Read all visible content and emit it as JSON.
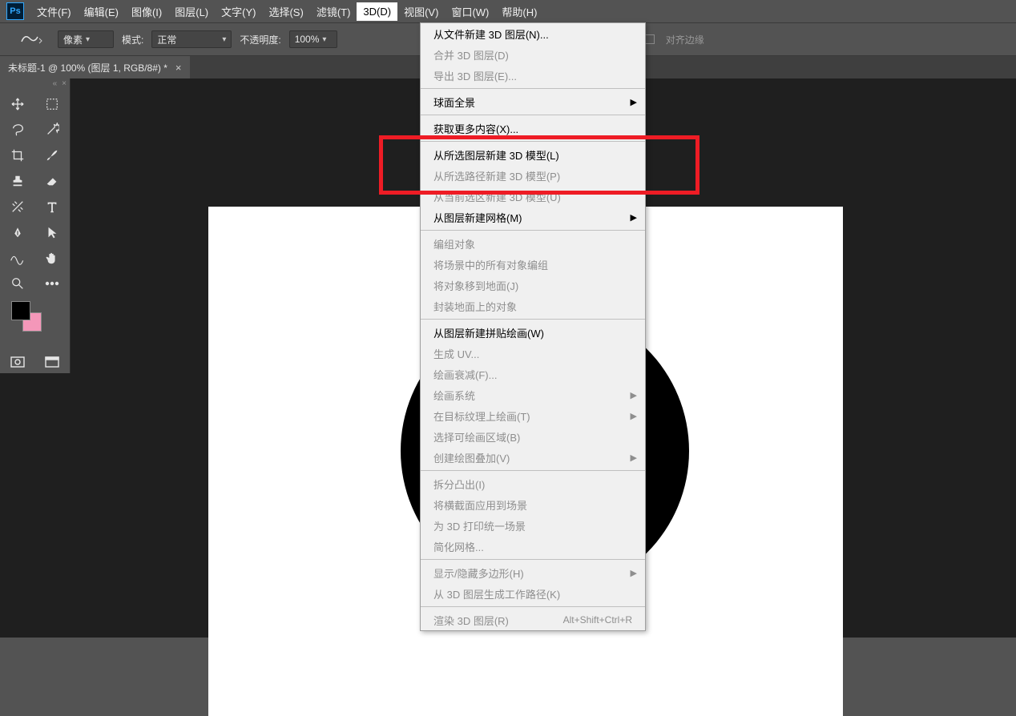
{
  "menubar": {
    "items": [
      {
        "label": "文件(F)"
      },
      {
        "label": "编辑(E)"
      },
      {
        "label": "图像(I)"
      },
      {
        "label": "图层(L)"
      },
      {
        "label": "文字(Y)"
      },
      {
        "label": "选择(S)"
      },
      {
        "label": "滤镜(T)"
      },
      {
        "label": "3D(D)"
      },
      {
        "label": "视图(V)"
      },
      {
        "label": "窗口(W)"
      },
      {
        "label": "帮助(H)"
      }
    ],
    "active_index": 7
  },
  "optionsbar": {
    "size_field": "像素",
    "mode_label": "模式:",
    "mode_value": "正常",
    "opacity_label": "不透明度:",
    "opacity_value": "100%",
    "align_edges_label": "对齐边缘"
  },
  "tabbar": {
    "tab_title": "未标题-1 @ 100% (图层 1, RGB/8#) *"
  },
  "dropdown": {
    "groups": [
      [
        {
          "label": "从文件新建 3D 图层(N)...",
          "enabled": true
        },
        {
          "label": "合并 3D 图层(D)",
          "enabled": false
        },
        {
          "label": "导出 3D 图层(E)...",
          "enabled": false
        }
      ],
      [
        {
          "label": "球面全景",
          "enabled": true,
          "submenu": true
        }
      ],
      [
        {
          "label": "获取更多内容(X)...",
          "enabled": true
        }
      ],
      [
        {
          "label": "从所选图层新建 3D 模型(L)",
          "enabled": true
        },
        {
          "label": "从所选路径新建 3D 模型(P)",
          "enabled": false
        },
        {
          "label": "从当前选区新建 3D 模型(U)",
          "enabled": false
        },
        {
          "label": "从图层新建网格(M)",
          "enabled": true,
          "submenu": true
        }
      ],
      [
        {
          "label": "编组对象",
          "enabled": false
        },
        {
          "label": "将场景中的所有对象编组",
          "enabled": false
        },
        {
          "label": "将对象移到地面(J)",
          "enabled": false
        },
        {
          "label": "封装地面上的对象",
          "enabled": false
        }
      ],
      [
        {
          "label": "从图层新建拼贴绘画(W)",
          "enabled": true
        },
        {
          "label": "生成 UV...",
          "enabled": false
        },
        {
          "label": "绘画衰减(F)...",
          "enabled": false
        },
        {
          "label": "绘画系统",
          "enabled": false,
          "submenu": true
        },
        {
          "label": "在目标纹理上绘画(T)",
          "enabled": false,
          "submenu": true
        },
        {
          "label": "选择可绘画区域(B)",
          "enabled": false
        },
        {
          "label": "创建绘图叠加(V)",
          "enabled": false,
          "submenu": true
        }
      ],
      [
        {
          "label": "拆分凸出(I)",
          "enabled": false
        },
        {
          "label": "将横截面应用到场景",
          "enabled": false
        },
        {
          "label": "为 3D 打印统一场景",
          "enabled": false
        },
        {
          "label": "简化网格...",
          "enabled": false
        }
      ],
      [
        {
          "label": "显示/隐藏多边形(H)",
          "enabled": false,
          "submenu": true
        },
        {
          "label": "从 3D 图层生成工作路径(K)",
          "enabled": false
        }
      ],
      [
        {
          "label": "渲染 3D 图层(R)",
          "enabled": false,
          "shortcut": "Alt+Shift+Ctrl+R"
        }
      ]
    ]
  },
  "tools": {
    "grid": [
      "move",
      "marquee",
      "lasso",
      "magic-wand",
      "crop",
      "eyedropper",
      "spot-heal",
      "eraser",
      "brush",
      "clone",
      "text",
      "pen",
      "path-select",
      "shape",
      "hand",
      "puppet",
      "zoom",
      "more"
    ],
    "bottom": [
      "quickmask",
      "screenmode"
    ]
  },
  "swatches": {
    "fg": "#000000",
    "bg": "#f497b9"
  },
  "logo_text": "Ps"
}
